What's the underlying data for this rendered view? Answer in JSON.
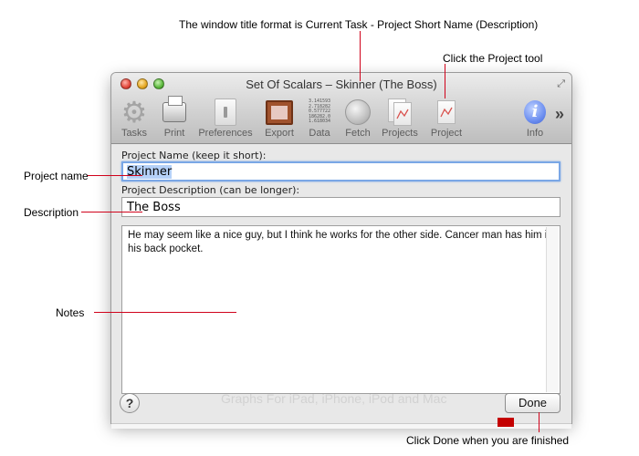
{
  "annotations": {
    "title_format": "The window title format is Current Task - Project Short Name (Description)",
    "project_tool": "Click the Project tool",
    "project_name": "Project name",
    "description": "Description",
    "notes": "Notes",
    "done": "Click Done when you are finished"
  },
  "window": {
    "title": "Set Of Scalars – Skinner (The Boss)"
  },
  "toolbar": {
    "tasks": "Tasks",
    "print": "Print",
    "preferences": "Preferences",
    "export": "Export",
    "data": "Data",
    "data_icon_numbers": [
      "3.141593",
      "2.718282",
      "0.577722",
      "186282.0",
      "1.618034"
    ],
    "fetch": "Fetch",
    "projects": "Projects",
    "project": "Project",
    "info": "Info"
  },
  "form": {
    "name_label": "Project Name (keep it short):",
    "name_value": "Skinner",
    "description_label": "Project Description (can be longer):",
    "description_value": "The Boss",
    "notes_value": "He may seem like a nice guy, but I think he works for the other side. Cancer man has him in his back pocket.",
    "help_label": "?",
    "done_label": "Done"
  },
  "background_text": "Graphs For iPad, iPhone, iPod and Mac",
  "colors": {
    "annotation_line": "#d0021b",
    "selection": "#b5d1f8",
    "focus_ring": "#7aa7e6"
  }
}
